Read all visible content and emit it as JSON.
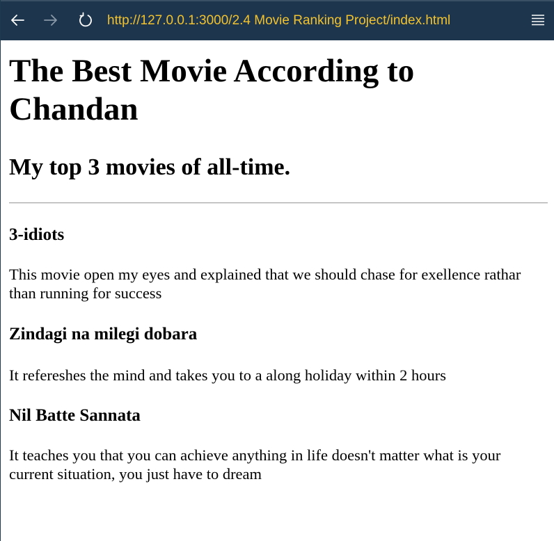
{
  "browser": {
    "url": "http://127.0.0.1:3000/2.4 Movie Ranking Project/index.html",
    "icons": {
      "back": "arrow-left-icon",
      "forward": "arrow-right-icon",
      "reload": "reload-icon",
      "menu": "hamburger-menu-icon"
    },
    "colors": {
      "toolbar_bg": "#1d364d",
      "url_text": "#f2c22e",
      "icon": "#ffffff",
      "icon_disabled": "#8a99a8"
    }
  },
  "page": {
    "title": "The Best Movie According to Chandan",
    "subtitle": "My top 3 movies of all-time.",
    "movies": [
      {
        "title": "3-idiots",
        "description": "This movie open my eyes and explained that we should chase for exellence rathar than running for success"
      },
      {
        "title": "Zindagi na milegi dobara",
        "description": "It refereshes the mind and takes you to a along holiday within 2 hours"
      },
      {
        "title": "Nil Batte Sannata",
        "description": "It teaches you that you can achieve anything in life doesn't matter what is your current situation, you just have to dream"
      }
    ]
  }
}
